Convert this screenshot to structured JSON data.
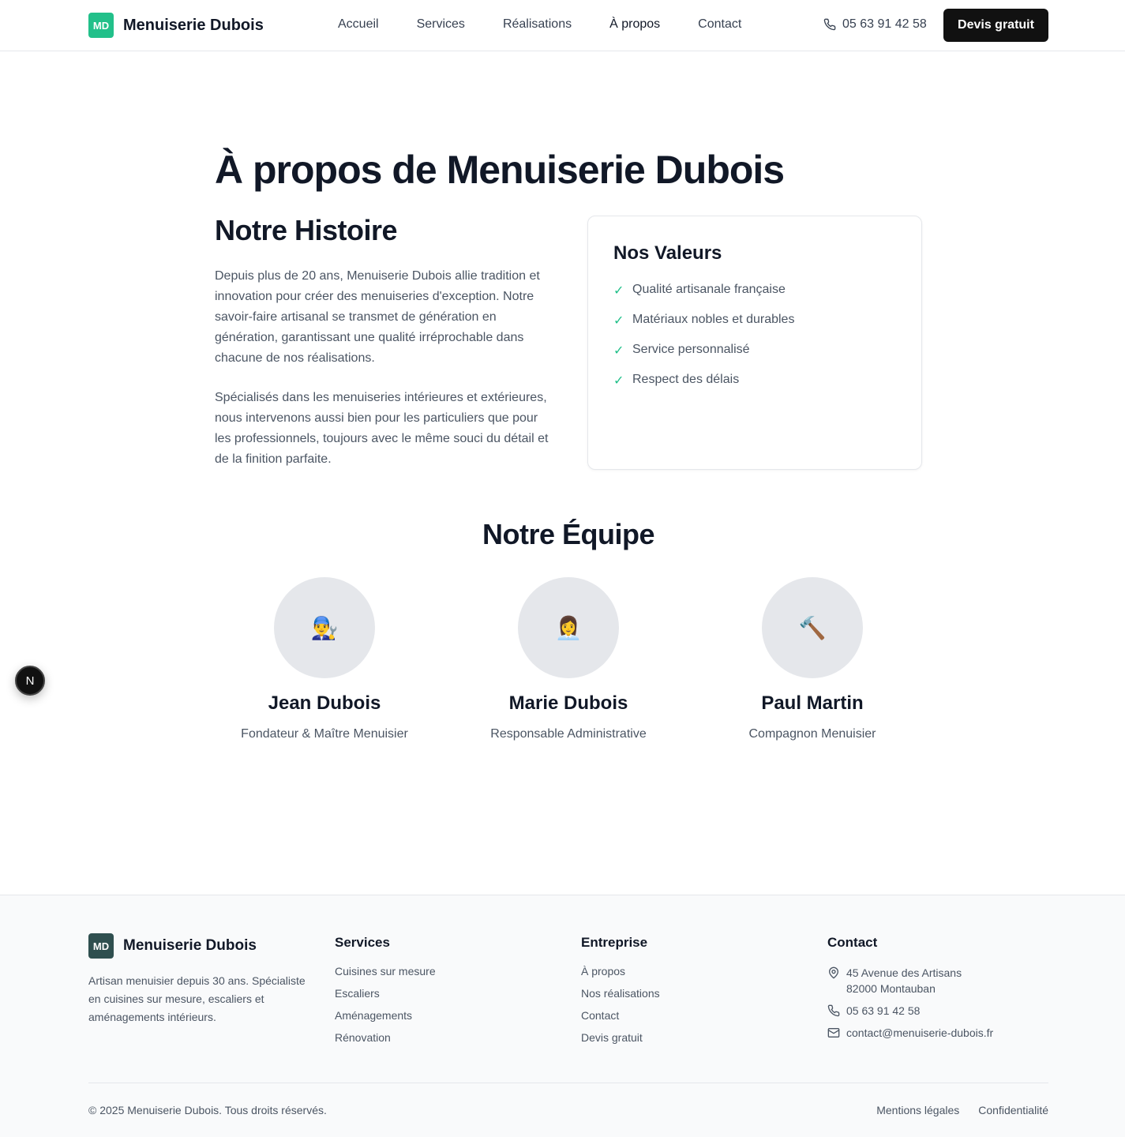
{
  "header": {
    "logo_badge": "MD",
    "logo_text": "Menuiserie Dubois",
    "nav": [
      "Accueil",
      "Services",
      "Réalisations",
      "À propos",
      "Contact"
    ],
    "active_nav": "À propos",
    "phone": "05 63 91 42 58",
    "cta": "Devis gratuit"
  },
  "main": {
    "page_title": "À propos de Menuiserie Dubois",
    "history_title": "Notre Histoire",
    "history_paragraphs": [
      "Depuis plus de 20 ans, Menuiserie Dubois allie tradition et innovation pour créer des menuiseries d'exception. Notre savoir-faire artisanal se transmet de génération en génération, garantissant une qualité irréprochable dans chacune de nos réalisations.",
      "Spécialisés dans les menuiseries intérieures et extérieures, nous intervenons aussi bien pour les particuliers que pour les professionnels, toujours avec le même souci du détail et de la finition parfaite."
    ],
    "values_title": "Nos Valeurs",
    "values": [
      "Qualité artisanale française",
      "Matériaux nobles et durables",
      "Service personnalisé",
      "Respect des délais"
    ],
    "check_mark": "✓",
    "team_title": "Notre Équipe",
    "team": [
      {
        "emoji": "👨‍🔧",
        "name": "Jean Dubois",
        "role": "Fondateur & Maître Menuisier"
      },
      {
        "emoji": "👩‍💼",
        "name": "Marie Dubois",
        "role": "Responsable Administrative"
      },
      {
        "emoji": "🔨",
        "name": "Paul Martin",
        "role": "Compagnon Menuisier"
      }
    ]
  },
  "floating_button": "N",
  "footer": {
    "logo_badge": "MD",
    "logo_text": "Menuiserie Dubois",
    "description": "Artisan menuisier depuis 30 ans. Spécialiste en cuisines sur mesure, escaliers et aménagements intérieurs.",
    "services_title": "Services",
    "services": [
      "Cuisines sur mesure",
      "Escaliers",
      "Aménagements",
      "Rénovation"
    ],
    "company_title": "Entreprise",
    "company": [
      "À propos",
      "Nos réalisations",
      "Contact",
      "Devis gratuit"
    ],
    "contact_title": "Contact",
    "address_line1": "45 Avenue des Artisans",
    "address_line2": "82000 Montauban",
    "phone": "05 63 91 42 58",
    "email": "contact@menuiserie-dubois.fr",
    "copyright": "© 2025 Menuiserie Dubois. Tous droits réservés.",
    "legal": [
      "Mentions légales",
      "Confidentialité"
    ]
  },
  "colors": {
    "brand_green": "#22c08a",
    "footer_badge": "#2f4f4f",
    "cta_bg": "#111111"
  }
}
